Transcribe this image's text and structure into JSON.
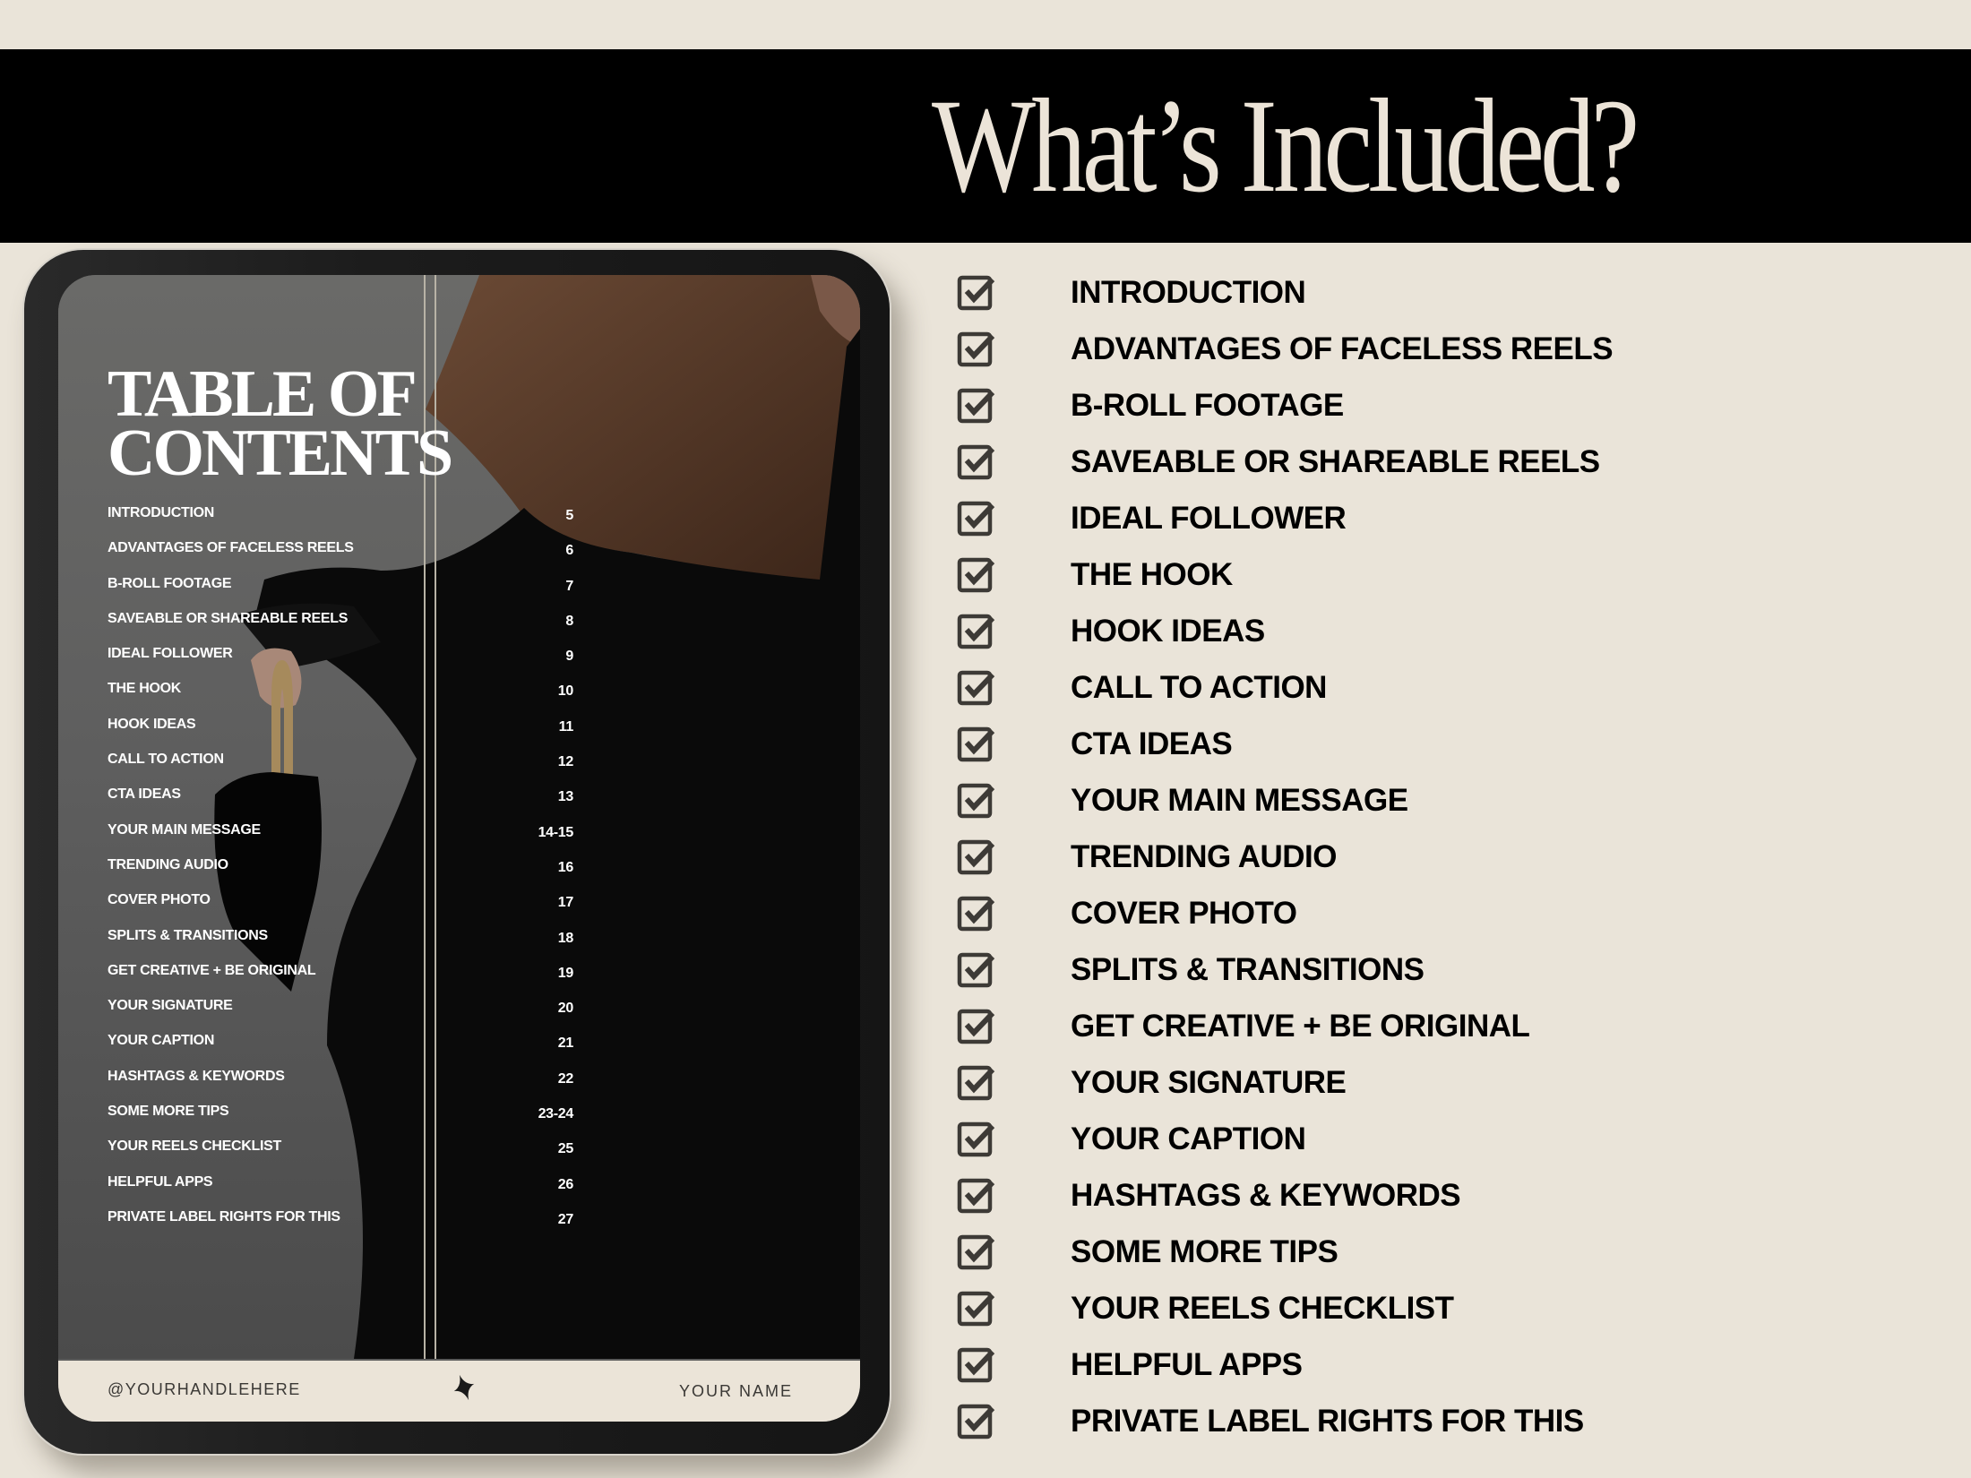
{
  "header": {
    "title": "What’s Included?"
  },
  "colors": {
    "background": "#eae4d9",
    "banner": "#000000",
    "title_text": "#ece4d8",
    "checkbox": "#3d3a36",
    "list_text": "#000000"
  },
  "tablet": {
    "page_title_line1": "TABLE OF",
    "page_title_line2": "CONTENTS",
    "toc": [
      {
        "label": "INTRODUCTION",
        "page": "5"
      },
      {
        "label": "ADVANTAGES OF FACELESS REELS",
        "page": "6"
      },
      {
        "label": "B-ROLL FOOTAGE",
        "page": "7"
      },
      {
        "label": "SAVEABLE OR SHAREABLE REELS",
        "page": "8"
      },
      {
        "label": "IDEAL FOLLOWER",
        "page": "9"
      },
      {
        "label": "THE HOOK",
        "page": "10"
      },
      {
        "label": "HOOK IDEAS",
        "page": "11"
      },
      {
        "label": "CALL TO ACTION",
        "page": "12"
      },
      {
        "label": "CTA IDEAS",
        "page": "13"
      },
      {
        "label": "YOUR MAIN MESSAGE",
        "page": "14-15"
      },
      {
        "label": "TRENDING AUDIO",
        "page": "16"
      },
      {
        "label": "COVER PHOTO",
        "page": "17"
      },
      {
        "label": "SPLITS & TRANSITIONS",
        "page": "18"
      },
      {
        "label": "GET CREATIVE + BE ORIGINAL",
        "page": "19"
      },
      {
        "label": "YOUR SIGNATURE",
        "page": "20"
      },
      {
        "label": "YOUR CAPTION",
        "page": "21"
      },
      {
        "label": "HASHTAGS & KEYWORDS",
        "page": "22"
      },
      {
        "label": "SOME MORE TIPS",
        "page": "23-24"
      },
      {
        "label": "YOUR REELS CHECKLIST",
        "page": "25"
      },
      {
        "label": "HELPFUL APPS",
        "page": "26"
      },
      {
        "label": "PRIVATE LABEL RIGHTS FOR THIS",
        "page": "27"
      }
    ],
    "footer": {
      "handle": "@YOURHANDLEHERE",
      "name": "YOUR NAME",
      "icon": "sparkle-icon"
    }
  },
  "checklist": {
    "icon": "checkbox-checked-icon",
    "items": [
      "INTRODUCTION",
      "ADVANTAGES OF FACELESS REELS",
      "B-ROLL FOOTAGE",
      "SAVEABLE OR SHAREABLE REELS",
      "IDEAL FOLLOWER",
      "THE HOOK",
      "HOOK IDEAS",
      "CALL TO ACTION",
      "CTA IDEAS",
      "YOUR MAIN MESSAGE",
      "TRENDING AUDIO",
      "COVER PHOTO",
      "SPLITS & TRANSITIONS",
      "GET CREATIVE + BE ORIGINAL",
      "YOUR SIGNATURE",
      "YOUR CAPTION",
      "HASHTAGS & KEYWORDS",
      "SOME MORE TIPS",
      "YOUR REELS CHECKLIST",
      "HELPFUL APPS",
      "PRIVATE LABEL RIGHTS FOR THIS"
    ]
  }
}
